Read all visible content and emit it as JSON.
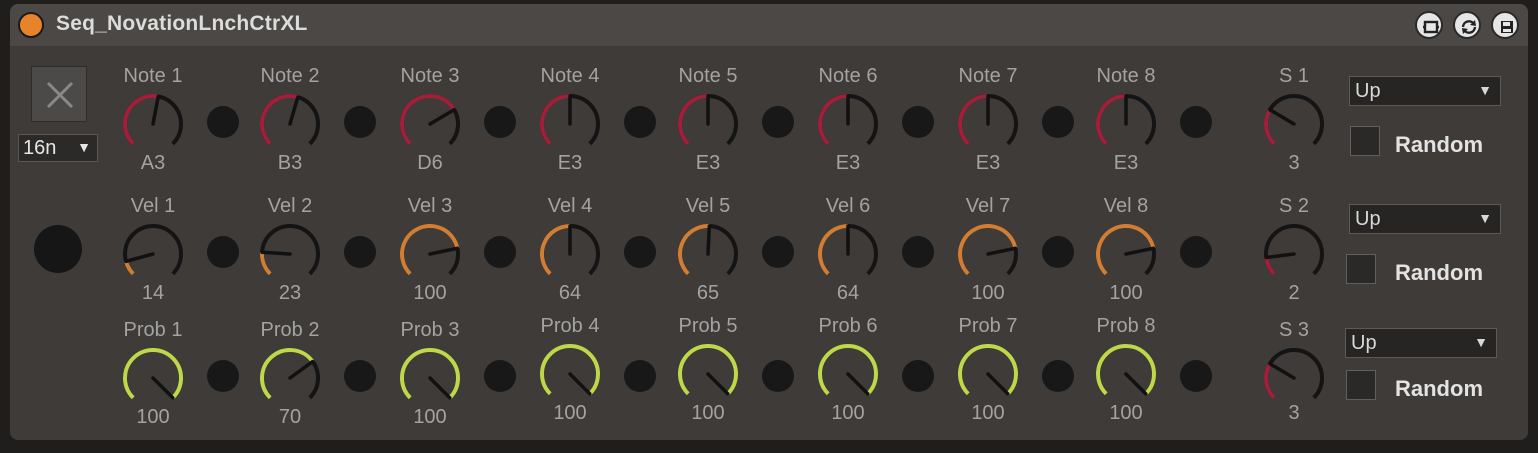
{
  "device": {
    "title": "Seq_NovationLnchCtrXL",
    "rate": "16n",
    "header_icons": [
      "view-icon",
      "refresh-icon",
      "save-icon"
    ],
    "colors": {
      "note_arc": "#a21f3a",
      "vel_arc": "#d17e34",
      "prob_arc": "#bfd84a",
      "knob_track": "#141414",
      "power": "#e8822b"
    }
  },
  "rows": [
    {
      "id": "note",
      "color": "#a21f3a",
      "knobs": [
        {
          "label": "Note 1",
          "value": "A3",
          "level": 0.54
        },
        {
          "label": "Note 2",
          "value": "B3",
          "level": 0.56
        },
        {
          "label": "Note 3",
          "value": "D6",
          "level": 0.72
        },
        {
          "label": "Note 4",
          "value": "E3",
          "level": 0.5
        },
        {
          "label": "Note 5",
          "value": "E3",
          "level": 0.5
        },
        {
          "label": "Note 6",
          "value": "E3",
          "level": 0.5
        },
        {
          "label": "Note 7",
          "value": "E3",
          "level": 0.5
        },
        {
          "label": "Note 8",
          "value": "E3",
          "level": 0.5
        }
      ]
    },
    {
      "id": "vel",
      "color": "#d17e34",
      "knobs": [
        {
          "label": "Vel 1",
          "value": "14",
          "level": 0.11
        },
        {
          "label": "Vel 2",
          "value": "23",
          "level": 0.18
        },
        {
          "label": "Vel 3",
          "value": "100",
          "level": 0.79
        },
        {
          "label": "Vel 4",
          "value": "64",
          "level": 0.5
        },
        {
          "label": "Vel 5",
          "value": "65",
          "level": 0.51
        },
        {
          "label": "Vel 6",
          "value": "64",
          "level": 0.5
        },
        {
          "label": "Vel 7",
          "value": "100",
          "level": 0.79
        },
        {
          "label": "Vel 8",
          "value": "100",
          "level": 0.79
        }
      ]
    },
    {
      "id": "prob",
      "color": "#bfd84a",
      "knobs": [
        {
          "label": "Prob 1",
          "value": "100",
          "level": 1.0
        },
        {
          "label": "Prob 2",
          "value": "70",
          "level": 0.7
        },
        {
          "label": "Prob 3",
          "value": "100",
          "level": 1.0
        },
        {
          "label": "Prob 4",
          "value": "100",
          "level": 1.0
        },
        {
          "label": "Prob 5",
          "value": "100",
          "level": 1.0
        },
        {
          "label": "Prob 6",
          "value": "100",
          "level": 1.0
        },
        {
          "label": "Prob 7",
          "value": "100",
          "level": 1.0
        },
        {
          "label": "Prob 8",
          "value": "100",
          "level": 1.0
        }
      ]
    }
  ],
  "steps": [
    {
      "label": "S 1",
      "value": "3",
      "level": 0.28,
      "direction": "Up",
      "random_label": "Random",
      "random_checked": false
    },
    {
      "label": "S 2",
      "value": "2",
      "level": 0.14,
      "direction": "Up",
      "random_label": "Random",
      "random_checked": false
    },
    {
      "label": "S 3",
      "value": "3",
      "level": 0.28,
      "direction": "Up",
      "random_label": "Random",
      "random_checked": false
    }
  ]
}
